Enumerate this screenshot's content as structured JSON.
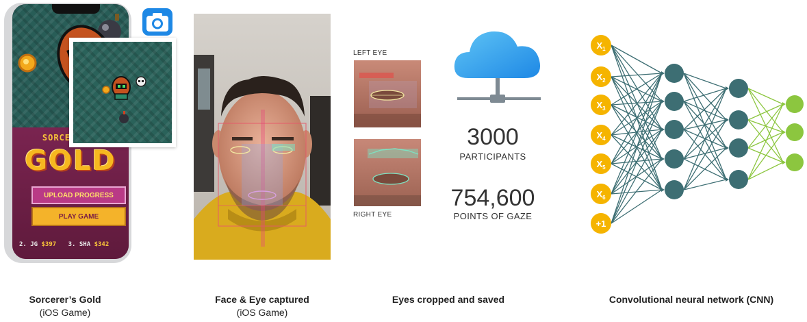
{
  "game": {
    "title_word_top": "SORCERER'S",
    "title_word_main": "GOLD",
    "upload_label": "UPLOAD PROGRESS",
    "play_label": "PLAY GAME",
    "leaderboard": [
      {
        "rank": "2. JG",
        "score": "$397"
      },
      {
        "rank": "3. SHA",
        "score": "$342"
      }
    ]
  },
  "eyes": {
    "left_label": "LEFT EYE",
    "right_label": "RIGHT EYE"
  },
  "stats": {
    "participants_value": "3000",
    "participants_label": "PARTICIPANTS",
    "gaze_value": "754,600",
    "gaze_label": "POINTS OF GAZE"
  },
  "network": {
    "inputs": [
      "X1",
      "X2",
      "X3",
      "X4",
      "X5",
      "X6",
      "+1"
    ],
    "input_color": "#f5b400",
    "hidden_color": "#3d6e73",
    "output_color": "#8cc63f",
    "edge_color_hidden": "#3d6e73",
    "edge_color_output": "#8cc63f"
  },
  "captions": [
    {
      "title": "Sorcerer’s Gold",
      "subtitle": "(iOS Game)"
    },
    {
      "title": "Face & Eye captured",
      "subtitle": "(iOS Game)"
    },
    {
      "title": "Eyes cropped and saved",
      "subtitle": ""
    },
    {
      "title": "Convolutional neural network (CNN)",
      "subtitle": ""
    }
  ],
  "icons": [
    "camera-icon",
    "cloud-network-icon"
  ]
}
